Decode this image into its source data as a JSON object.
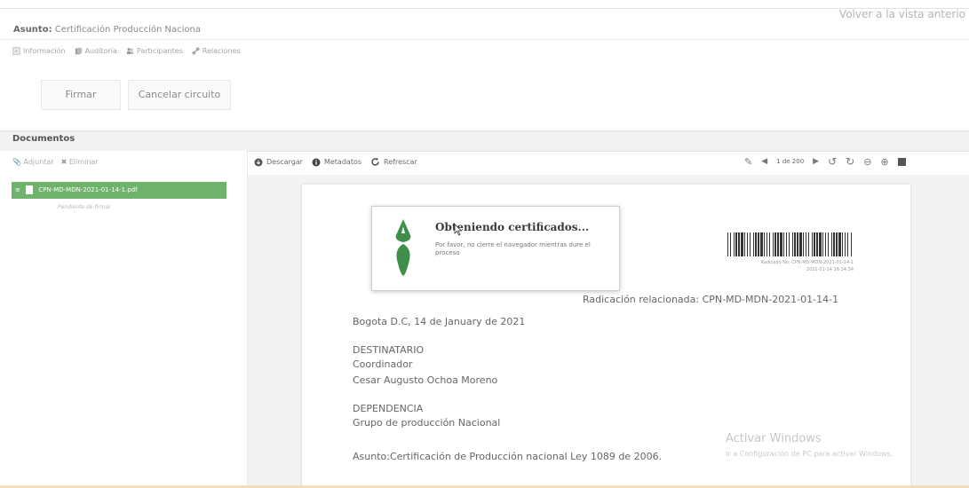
{
  "header": {
    "back_link": "Volver a la vista anterio",
    "asunto_label": "Asunto:",
    "asunto_value": "Certificación Producción Naciona"
  },
  "tabs": [
    {
      "label": "Información",
      "icon": "info-icon"
    },
    {
      "label": "Auditoría",
      "icon": "audit-icon"
    },
    {
      "label": "Participantes",
      "icon": "participants-icon"
    },
    {
      "label": "Relaciones",
      "icon": "link-icon"
    }
  ],
  "actions": {
    "sign": "Firmar",
    "cancel_circuit": "Cancelar circuito"
  },
  "documents": {
    "title": "Documentos",
    "attach": "Adjuntar",
    "delete": "Eliminar",
    "file_name": "CPN-MD-MDN-2021-01-14-1.pdf",
    "file_status": "Pendiente de firmar"
  },
  "viewer": {
    "download": "Descargar",
    "metadata": "Metadatos",
    "refresh": "Refrescar",
    "page_indicator": "1 de 200"
  },
  "modal": {
    "title": "Obteniendo certificados...",
    "message": "Por favor, no cierre el navegador mientras dure el proceso"
  },
  "document_page": {
    "barcode_caption_1": "Radicado No: CPN-MD-MDN-2021-01-14-1",
    "barcode_caption_2": "2021-01-14 16:34:34",
    "radicacion": "Radicación relacionada: CPN-MD-MDN-2021-01-14-1",
    "date_line": "Bogota D.C, 14 de January de 2021",
    "recipient_label": "DESTINATARIO",
    "recipient_role": "Coordinador",
    "recipient_name": "Cesar Augusto Ochoa Moreno",
    "dependency_label": "DEPENDENCIA",
    "dependency_name": "Grupo de producción Nacional",
    "subject": "Asunto:Certificación de Producción nacional Ley 1089 de 2006."
  },
  "watermark": {
    "title": "Activar Windows",
    "subtitle": "Ir a Configuración de PC para activar Windows."
  },
  "colors": {
    "file_highlight": "#6fb26c",
    "logo_green": "#3f8f4a"
  }
}
